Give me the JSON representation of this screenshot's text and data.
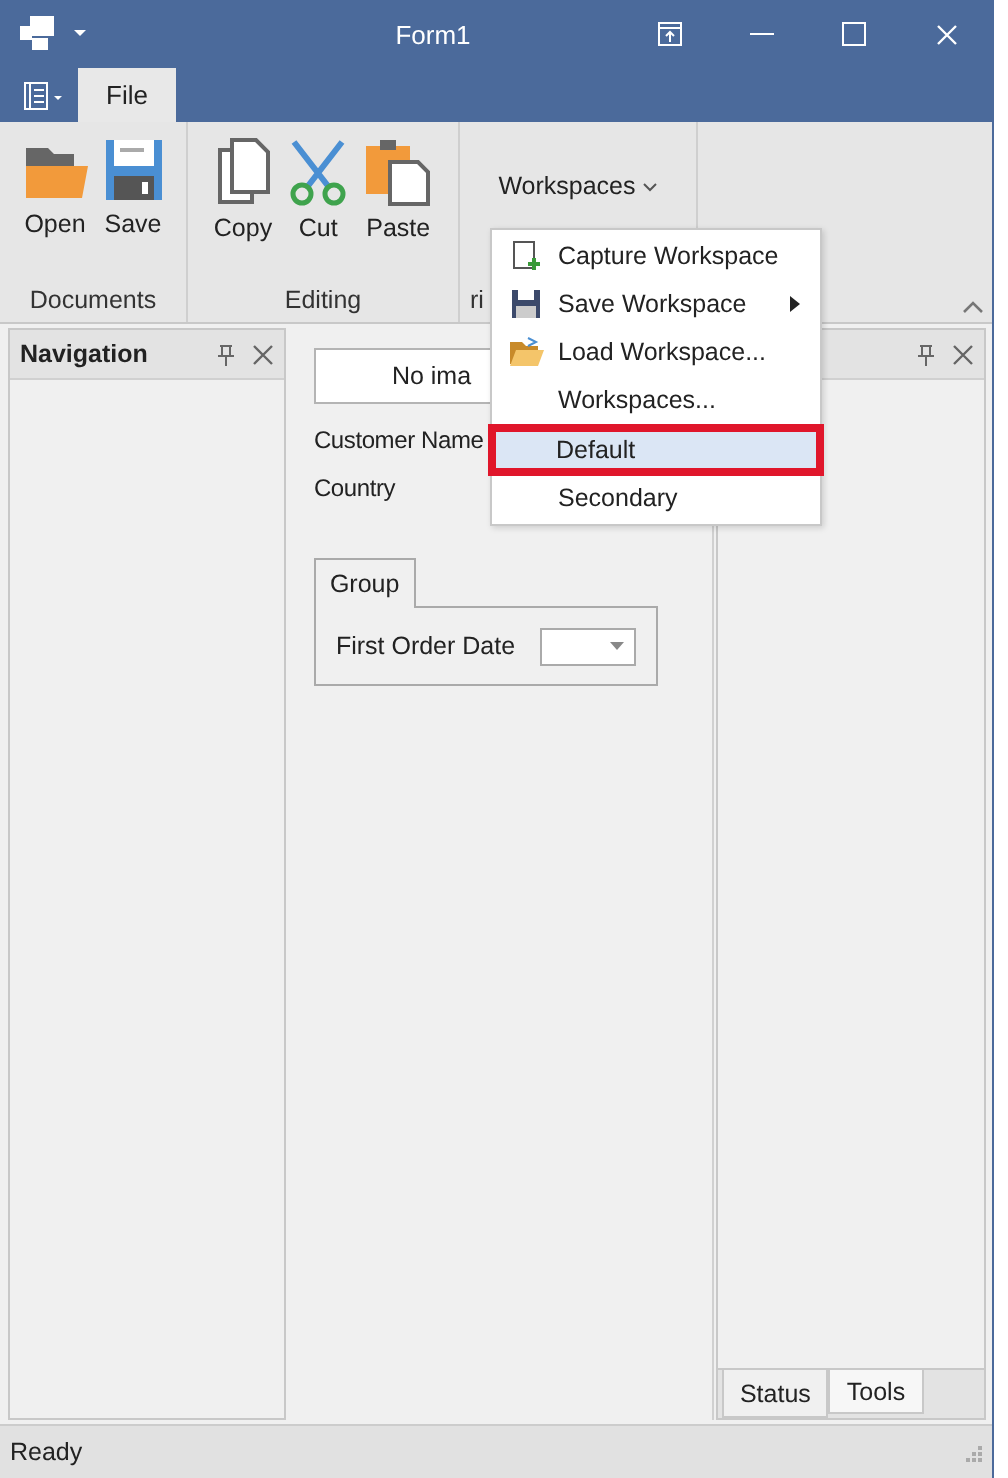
{
  "window": {
    "title": "Form1"
  },
  "ribbon": {
    "tabs": [
      {
        "label": "File",
        "selected": true
      }
    ],
    "groups": [
      {
        "label": "Documents",
        "buttons": [
          {
            "label": "Open",
            "kind": "open"
          },
          {
            "label": "Save",
            "kind": "save"
          }
        ]
      },
      {
        "label": "Editing",
        "buttons": [
          {
            "label": "Copy",
            "kind": "copy"
          },
          {
            "label": "Cut",
            "kind": "cut"
          },
          {
            "label": "Paste",
            "kind": "paste"
          }
        ]
      },
      {
        "label": "ri",
        "dropdown": "Workspaces"
      }
    ]
  },
  "menu": {
    "items": [
      {
        "kind": "capture",
        "label": "Capture Workspace",
        "submenu": false,
        "selected": false
      },
      {
        "kind": "save",
        "label": "Save Workspace",
        "submenu": true,
        "selected": false
      },
      {
        "kind": "load",
        "label": "Load Workspace...",
        "submenu": false,
        "selected": false
      },
      {
        "kind": "plain",
        "label": "Workspaces...",
        "submenu": false,
        "selected": false
      },
      {
        "kind": "separator"
      },
      {
        "kind": "plain",
        "label": "Default",
        "submenu": false,
        "selected": true
      },
      {
        "kind": "plain",
        "label": "Secondary",
        "submenu": false,
        "selected": false
      }
    ]
  },
  "navigation": {
    "title": "Navigation"
  },
  "form": {
    "image_placeholder": "No ima",
    "fields": [
      "Customer Name",
      "Country"
    ],
    "group": {
      "tab": "Group",
      "fields": [
        {
          "label": "First Order Date"
        }
      ]
    }
  },
  "right_panel": {
    "tabs": [
      {
        "label": "Status",
        "selected": true
      },
      {
        "label": "Tools",
        "selected": false
      }
    ]
  },
  "status_bar": {
    "text": "Ready"
  }
}
